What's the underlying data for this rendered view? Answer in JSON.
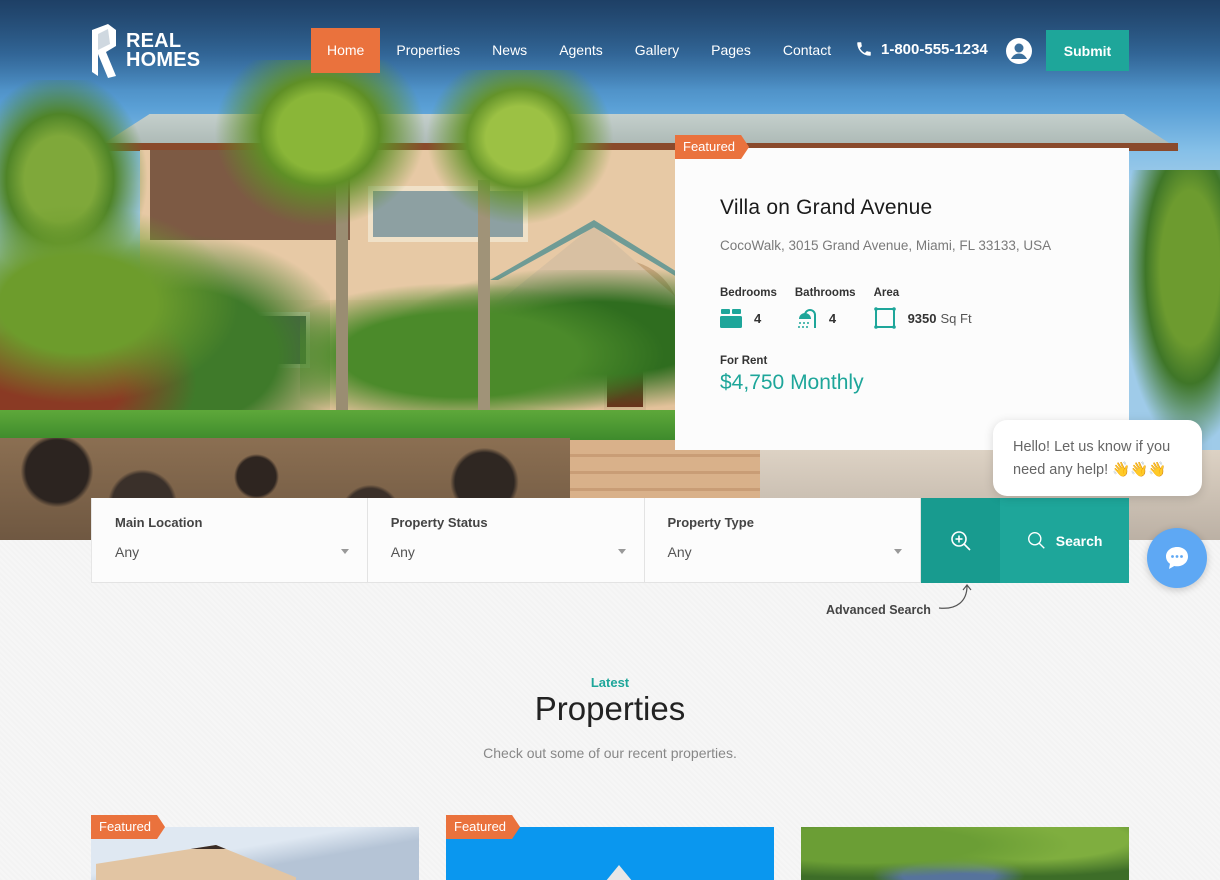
{
  "brand": {
    "line1": "REAL",
    "line2": "HOMES"
  },
  "nav": {
    "items": [
      {
        "label": "Home",
        "active": true
      },
      {
        "label": "Properties"
      },
      {
        "label": "News"
      },
      {
        "label": "Agents"
      },
      {
        "label": "Gallery"
      },
      {
        "label": "Pages"
      },
      {
        "label": "Contact"
      }
    ],
    "phone": "1-800-555-1234",
    "phone_icon": "phone-icon",
    "user_icon": "user-circle-icon",
    "submit_label": "Submit"
  },
  "featured": {
    "badge": "Featured",
    "title": "Villa on Grand Avenue",
    "address": "CocoWalk, 3015 Grand Avenue, Miami, FL 33133, USA",
    "meta": {
      "bedrooms_label": "Bedrooms",
      "bedrooms": "4",
      "bathrooms_label": "Bathrooms",
      "bathrooms": "4",
      "area_label": "Area",
      "area": "9350",
      "area_unit": "Sq Ft"
    },
    "status": "For Rent",
    "price": "$4,750 Monthly"
  },
  "chat": {
    "message": "Hello! Let us know if you need any help! 👋👋👋",
    "button_icon": "chat-icon"
  },
  "search": {
    "fields": [
      {
        "label": "Main Location",
        "value": "Any"
      },
      {
        "label": "Property Status",
        "value": "Any"
      },
      {
        "label": "Property Type",
        "value": "Any"
      }
    ],
    "advanced_icon": "zoom-in-icon",
    "search_label": "Search",
    "advanced_label": "Advanced Search"
  },
  "section": {
    "kicker": "Latest",
    "title": "Properties",
    "subtitle": "Check out some of our recent properties."
  },
  "cards": [
    {
      "badge": "Featured"
    },
    {
      "badge": "Featured"
    },
    {
      "badge": ""
    }
  ],
  "colors": {
    "accent_orange": "#ea723d",
    "accent_teal": "#1ea69a",
    "chat_blue": "#5ea8f4"
  }
}
